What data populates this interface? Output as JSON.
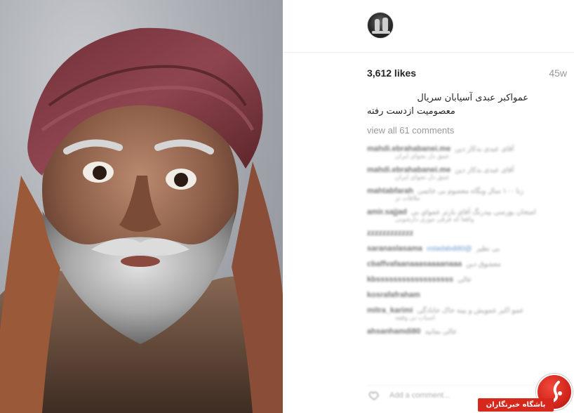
{
  "post": {
    "likes": "3,612 likes",
    "age": "45w",
    "caption_line1": "عمواکبر عبدی آسیابان سریال",
    "caption_line2": "معصومیت ازدست رفته",
    "view_all": "view all 61 comments",
    "add_comment_placeholder": "Add a comment..."
  },
  "comments": [
    {
      "user": "mahdi.ebrahabanei.me",
      "text": "آقای عبدی بدکار دین",
      "sub": "عمق دل نجواي ايران"
    },
    {
      "user": "mahdi.ebrahabanei.me",
      "text": "آقای عبدی بدکار دین",
      "sub": "عمق دل نجواي ايران"
    },
    {
      "user": "mahtabfarah",
      "text": "زنا ۱۰۰ سال وبگاه معصوم بی خاتمی",
      "sub": "ملاقات تر"
    },
    {
      "user": "amir.sajjad",
      "text": "امتحان بورسی بیدرنگ آقای بارتر عمواي بی",
      "sub": "واقعا که فرقی موزی دارشونی"
    },
    {
      "user": "zzzzzzzzzzzz",
      "text": "",
      "sub": ""
    },
    {
      "user": "saranaslasama",
      "text": "بی نظیر",
      "mention": "@ostadabdi80",
      "sub": ""
    },
    {
      "user": "cbaffvafaanaaasaaaanaaa",
      "text": "معشوق دین",
      "sub": ""
    },
    {
      "user": "kbssssssssssssssssss",
      "text": "عالی",
      "sub": ""
    },
    {
      "user": "kosrafafraham",
      "text": "",
      "sub": ""
    },
    {
      "user": "mitra_karimi",
      "text": "عمو اکبر عمويش و بینه خاک خانادگی",
      "sub": "اسباب بی وقفه"
    },
    {
      "user": "ahsanhamdi80",
      "text": "عالی بمانید",
      "sub": ""
    }
  ],
  "watermark": {
    "label": "باشگاه خبرنگاران",
    "icon": "jam-logo-icon",
    "color": "#d7281d"
  },
  "icons": {
    "avatar": "profile-avatar",
    "like": "heart-icon"
  }
}
